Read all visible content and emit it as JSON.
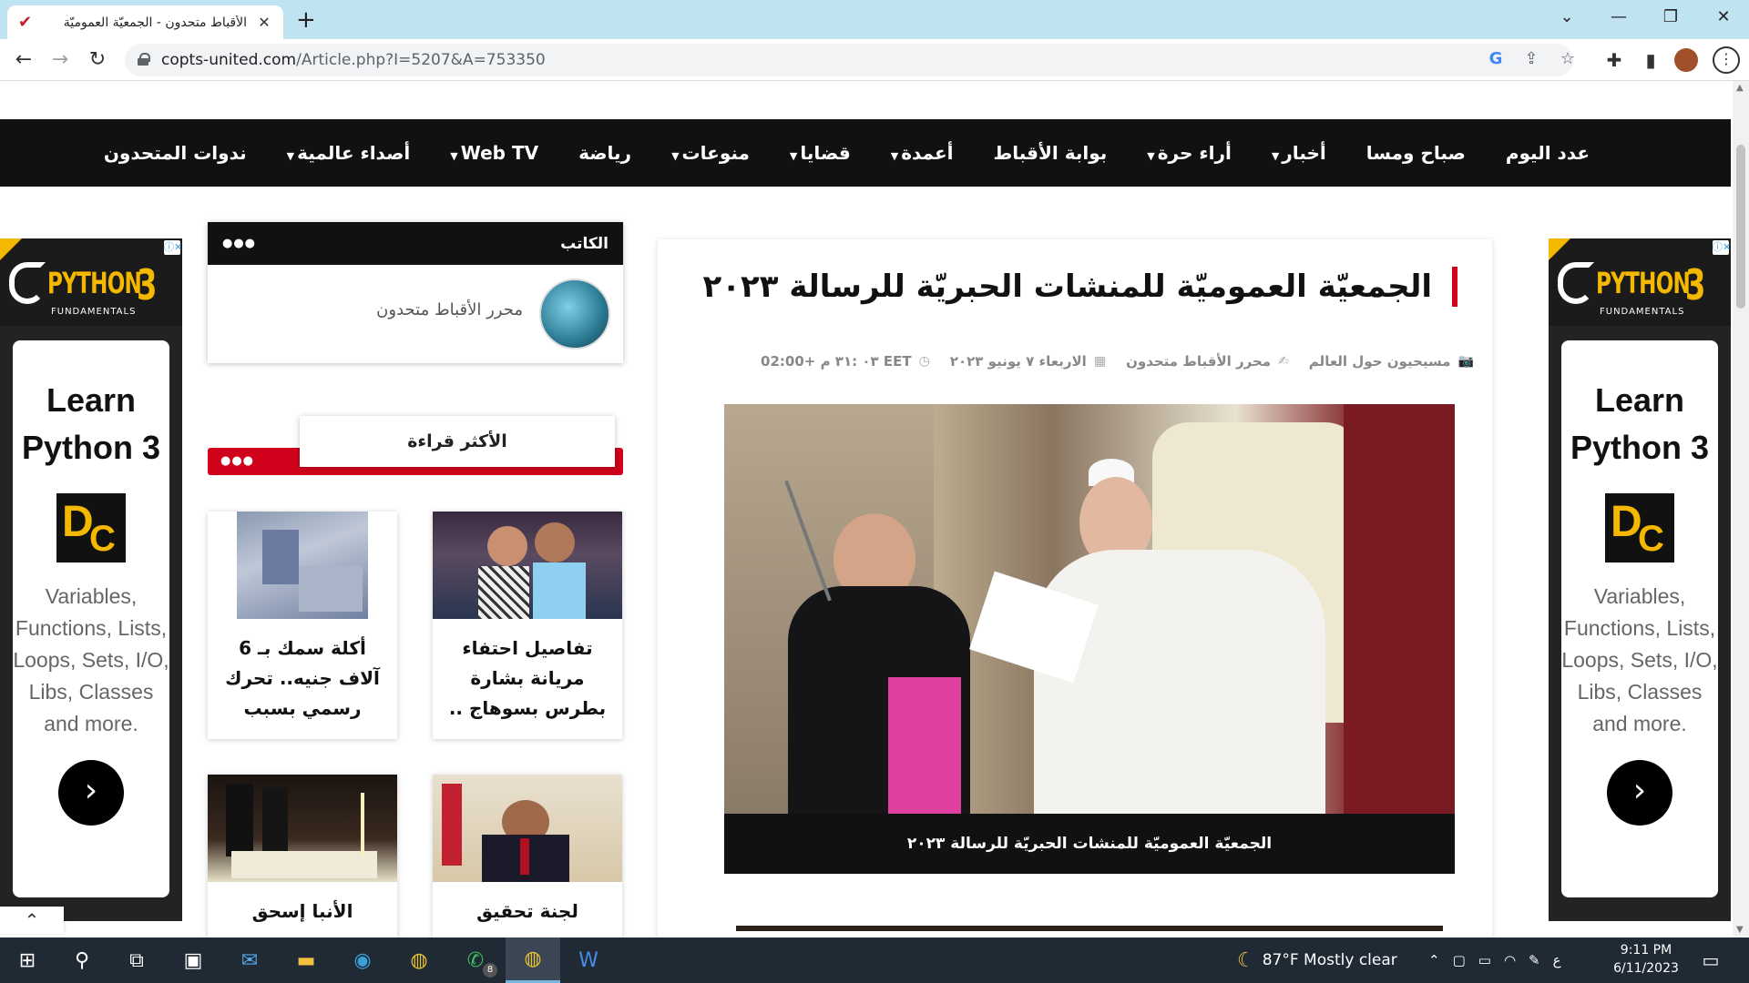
{
  "browser": {
    "tab_title": "الأقباط متحدون - الجمعيّة العموميّة",
    "url_host": "copts-united.com",
    "url_path": "/Article.php?I=5207&A=753350"
  },
  "nav": {
    "items": [
      {
        "label": "عدد اليوم",
        "caret": false
      },
      {
        "label": "صباح ومسا",
        "caret": false
      },
      {
        "label": "أخبار",
        "caret": true
      },
      {
        "label": "أراء حرة",
        "caret": true
      },
      {
        "label": "بوابة الأقباط",
        "caret": false
      },
      {
        "label": "أعمدة",
        "caret": true
      },
      {
        "label": "قضايا",
        "caret": true
      },
      {
        "label": "منوعات",
        "caret": true
      },
      {
        "label": "رياضة",
        "caret": false
      },
      {
        "label": "Web TV",
        "caret": true
      },
      {
        "label": "أصداء عالمية",
        "caret": true
      },
      {
        "label": "ندوات المتحدون",
        "caret": false
      }
    ]
  },
  "ad": {
    "brand": "PYTHON",
    "brand_num": "3",
    "sub": "FUNDAMENTALS",
    "title_line1": "Learn",
    "title_line2": "Python 3",
    "body": "Variables, Functions, Lists, Loops, Sets, I/O, Libs, Classes and more."
  },
  "writer": {
    "header": "الكاتب",
    "name": "محرر الأقباط متحدون"
  },
  "most_read": {
    "label": "الأكثر قراءة",
    "cards": [
      {
        "title": "تفاصيل احتفاء مريانة بشارة بطرس بسوهاج .."
      },
      {
        "title": "أكلة سمك بـ 6 آلاف جنيه.. تحرك رسمي بسبب"
      },
      {
        "title": "لجنة تحقيق"
      },
      {
        "title": "الأنبا إسحق"
      }
    ]
  },
  "article": {
    "title": "الجمعيّة العموميّة للمنشات الحبريّة للرسالة ٢٠٢٣",
    "category": "مسيحيون حول العالم",
    "author": "محرر الأقباط متحدون",
    "date": "الاربعاء ٧ يونيو ٢٠٢٣",
    "time": "٠٣ :٣١ م +02:00 EET",
    "caption": "الجمعيّة العموميّة للمنشات الحبريّة للرسالة ٢٠٢٣"
  },
  "taskbar": {
    "weather": "87°F  Mostly clear",
    "lang": "ع",
    "time": "9:11 PM",
    "date": "6/11/2023",
    "whatsapp_badge": "8"
  },
  "colors": {
    "accent_red": "#d0021b",
    "nav_bg": "#111111",
    "ad_yellow": "#f5b800",
    "tabbar": "#bfe3f1",
    "taskbar": "#1f2a35"
  }
}
